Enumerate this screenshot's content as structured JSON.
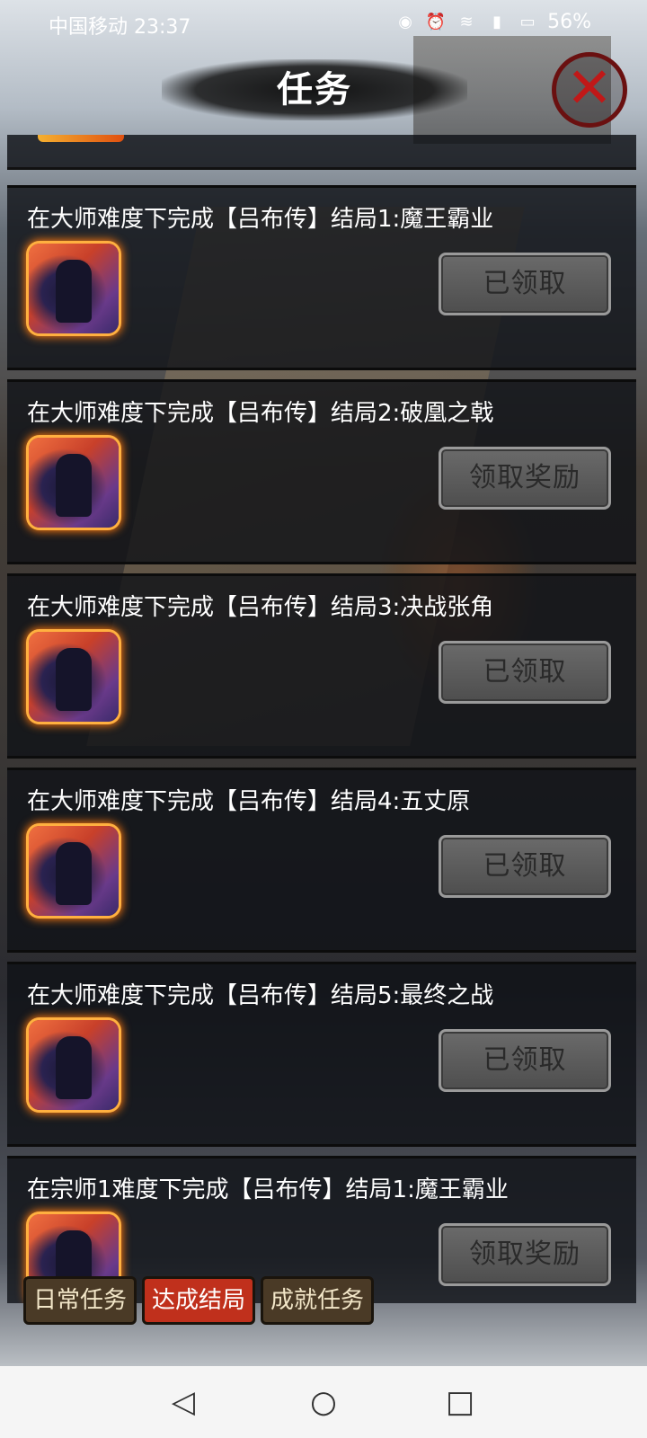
{
  "status_bar": {
    "carrier_time": "中国移动 23:37",
    "icons": [
      "eye-icon",
      "alarm-icon",
      "wifi-icon",
      "signal-icon",
      "battery-icon"
    ],
    "battery": "56%"
  },
  "header": {
    "title": "任务",
    "close_icon": "close-icon"
  },
  "tasks": [
    {
      "text": "在大师难度下完成【吕布传】结局1:魔王霸业",
      "button": "已领取"
    },
    {
      "text": "在大师难度下完成【吕布传】结局2:破凰之戟",
      "button": "领取奖励"
    },
    {
      "text": "在大师难度下完成【吕布传】结局3:决战张角",
      "button": "已领取"
    },
    {
      "text": "在大师难度下完成【吕布传】结局4:五丈原",
      "button": "已领取"
    },
    {
      "text": "在大师难度下完成【吕布传】结局5:最终之战",
      "button": "已领取"
    },
    {
      "text": "在宗师1难度下完成【吕布传】结局1:魔王霸业",
      "button": "领取奖励"
    }
  ],
  "tabs": [
    {
      "label": "日常任务",
      "active": false
    },
    {
      "label": "达成结局",
      "active": true
    },
    {
      "label": "成就任务",
      "active": false
    }
  ],
  "nav": {
    "back": "back-icon",
    "home": "home-icon",
    "recent": "recent-apps-icon"
  },
  "colors": {
    "active_tab": "#c0301c",
    "tab": "#4a3a26",
    "button": "#5c5c5c",
    "icon_glow": "#ff7a10"
  }
}
